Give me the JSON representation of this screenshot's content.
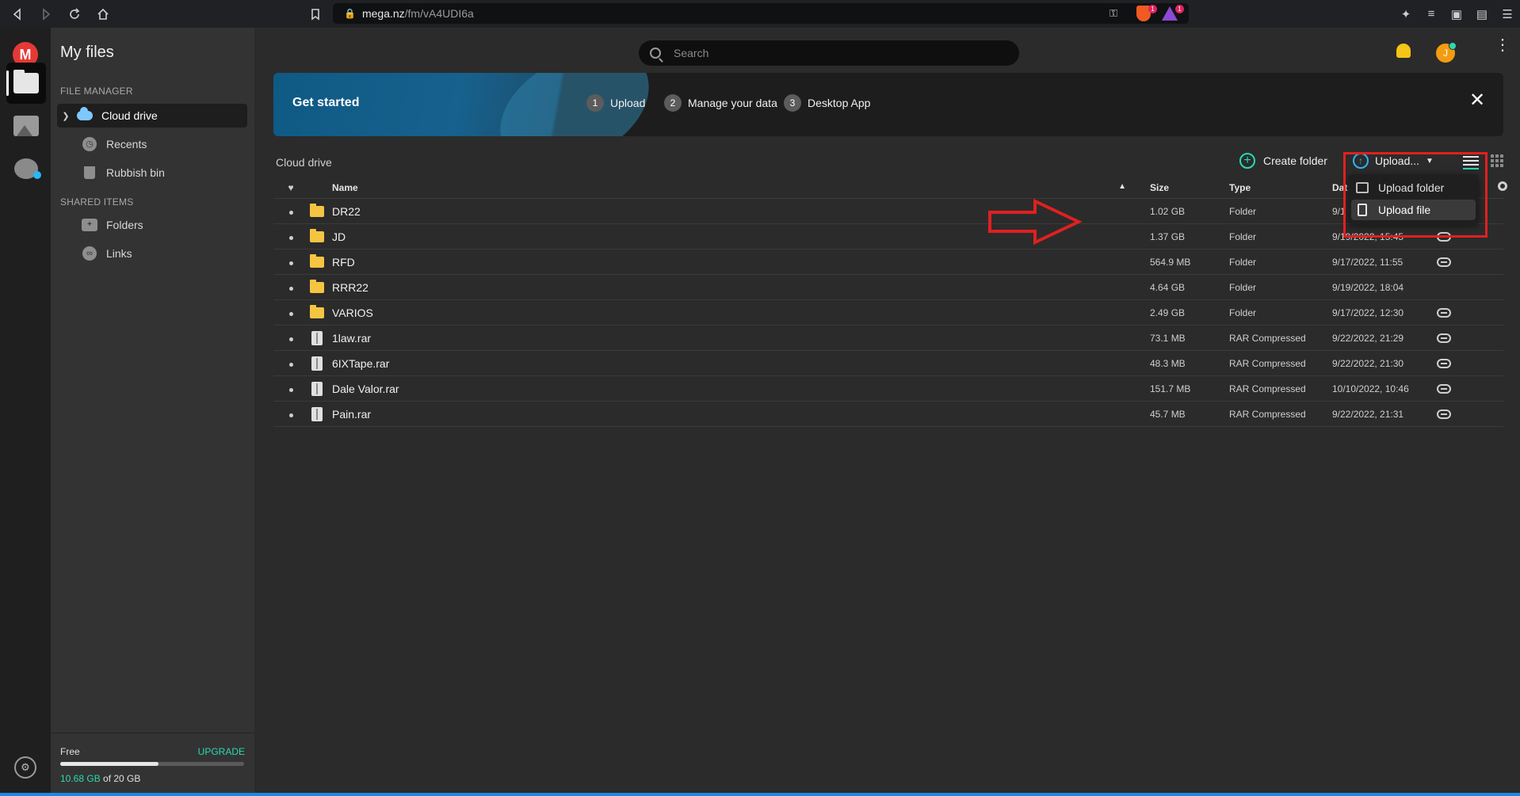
{
  "browser": {
    "url_host": "mega.nz",
    "url_path": "/fm/vA4UDI6a",
    "shield_badge": "1",
    "rewards_badge": "1"
  },
  "sidebar": {
    "title": "My files",
    "file_manager_label": "FILE MANAGER",
    "items": [
      {
        "label": "Cloud drive",
        "icon": "cloud-icon",
        "active": true
      },
      {
        "label": "Recents",
        "icon": "clock-icon"
      },
      {
        "label": "Rubbish bin",
        "icon": "bin-icon"
      }
    ],
    "shared_label": "SHARED ITEMS",
    "shared_items": [
      {
        "label": "Folders",
        "icon": "shared-folder-icon"
      },
      {
        "label": "Links",
        "icon": "link-icon"
      }
    ],
    "storage": {
      "plan": "Free",
      "upgrade": "UPGRADE",
      "used": "10.68 GB",
      "total": " of 20 GB",
      "used_fraction": 0.534
    }
  },
  "header": {
    "search_placeholder": "Search",
    "avatar_initial": "J"
  },
  "banner": {
    "title": "Get started",
    "steps": [
      {
        "num": "1",
        "label": "Upload"
      },
      {
        "num": "2",
        "label": "Manage your data"
      },
      {
        "num": "3",
        "label": "Desktop App"
      }
    ]
  },
  "toolbar": {
    "breadcrumb": "Cloud drive",
    "create_folder": "Create folder",
    "upload": "Upload..."
  },
  "dropdown": {
    "items": [
      "Upload folder",
      "Upload file"
    ]
  },
  "table": {
    "headers": {
      "name": "Name",
      "size": "Size",
      "type": "Type",
      "date": "Dat"
    },
    "rows": [
      {
        "name": "DR22",
        "size": "1.02 GB",
        "type": "Folder",
        "date": "9/1",
        "kind": "folder",
        "link": false
      },
      {
        "name": "JD",
        "size": "1.37 GB",
        "type": "Folder",
        "date": "9/19/2022, 15:45",
        "kind": "folder",
        "link": true
      },
      {
        "name": "RFD",
        "size": "564.9 MB",
        "type": "Folder",
        "date": "9/17/2022, 11:55",
        "kind": "folder",
        "link": true
      },
      {
        "name": "RRR22",
        "size": "4.64 GB",
        "type": "Folder",
        "date": "9/19/2022, 18:04",
        "kind": "folder",
        "link": false
      },
      {
        "name": "VARIOS",
        "size": "2.49 GB",
        "type": "Folder",
        "date": "9/17/2022, 12:30",
        "kind": "folder",
        "link": true
      },
      {
        "name": "1law.rar",
        "size": "73.1 MB",
        "type": "RAR Compressed",
        "date": "9/22/2022, 21:29",
        "kind": "archive",
        "link": true
      },
      {
        "name": "6IXTape.rar",
        "size": "48.3 MB",
        "type": "RAR Compressed",
        "date": "9/22/2022, 21:30",
        "kind": "archive",
        "link": true
      },
      {
        "name": "Dale Valor.rar",
        "size": "151.7 MB",
        "type": "RAR Compressed",
        "date": "10/10/2022, 10:46",
        "kind": "archive",
        "link": true
      },
      {
        "name": "Pain.rar",
        "size": "45.7 MB",
        "type": "RAR Compressed",
        "date": "9/22/2022, 21:31",
        "kind": "archive",
        "link": true
      }
    ]
  },
  "colors": {
    "accent": "#2bd9b0",
    "annotation": "#e02020"
  }
}
